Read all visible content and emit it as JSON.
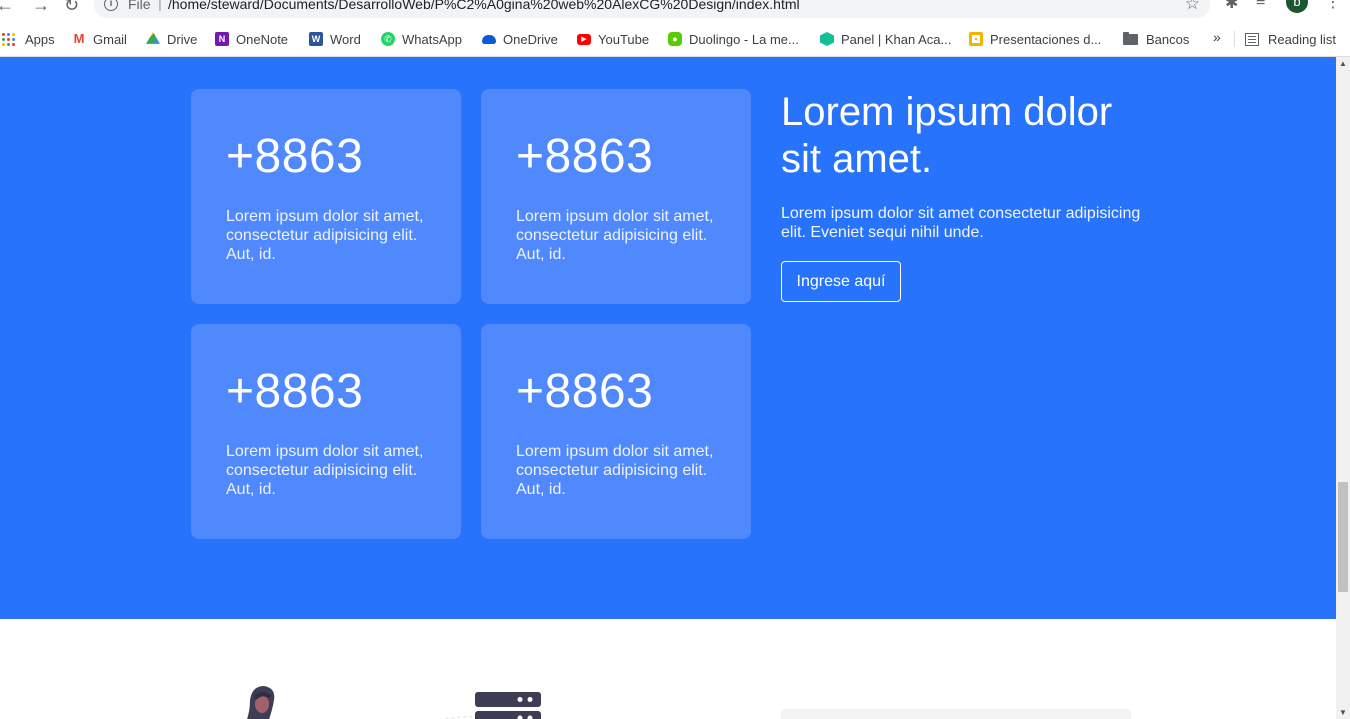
{
  "browser": {
    "address_scheme": "File",
    "address_url": "/home/steward/Documents/DesarrolloWeb/P%C2%A0gina%20web%20AlexCG%20Design/index.html",
    "profile_initial": "b",
    "bookmarks": [
      {
        "label": "Apps",
        "icon": "apps-grid-icon"
      },
      {
        "label": "Gmail",
        "icon": "gmail-icon",
        "color": "#ea4335"
      },
      {
        "label": "Drive",
        "icon": "drive-icon",
        "color": "#fbbc04"
      },
      {
        "label": "OneNote",
        "icon": "onenote-icon",
        "color": "#7719aa"
      },
      {
        "label": "Word",
        "icon": "word-icon",
        "color": "#2b579a"
      },
      {
        "label": "WhatsApp",
        "icon": "whatsapp-icon",
        "color": "#25d366"
      },
      {
        "label": "OneDrive",
        "icon": "onedrive-icon",
        "color": "#0a5bd3"
      },
      {
        "label": "YouTube",
        "icon": "youtube-icon",
        "color": "#ff0000"
      },
      {
        "label": "Duolingo - La me...",
        "icon": "duolingo-icon",
        "color": "#58cc02"
      },
      {
        "label": "Panel | Khan Aca...",
        "icon": "khan-academy-icon",
        "color": "#14bf96"
      },
      {
        "label": "Presentaciones d...",
        "icon": "slides-icon",
        "color": "#f4b400"
      },
      {
        "label": "Bancos",
        "icon": "folder-icon",
        "color": "#5f6368"
      }
    ],
    "overflow_label": "»",
    "reading_list_label": "Reading list"
  },
  "stats": {
    "cards": [
      {
        "number": "+8863",
        "text": "Lorem ipsum dolor sit amet, consectetur adipisicing elit. Aut, id."
      },
      {
        "number": "+8863",
        "text": "Lorem ipsum dolor sit amet, consectetur adipisicing elit. Aut, id."
      },
      {
        "number": "+8863",
        "text": "Lorem ipsum dolor sit amet, consectetur adipisicing elit. Aut, id."
      },
      {
        "number": "+8863",
        "text": "Lorem ipsum dolor sit amet, consectetur adipisicing elit. Aut, id."
      }
    ],
    "title": "Lorem ipsum dolor sit amet.",
    "text": "Lorem ipsum dolor sit amet consectetur adipisicing elit. Eveniet sequi nihil unde.",
    "button_label": "Ingrese aquí"
  },
  "colors": {
    "section_bg": "#2873fc",
    "card_bg": "#5088fd"
  }
}
